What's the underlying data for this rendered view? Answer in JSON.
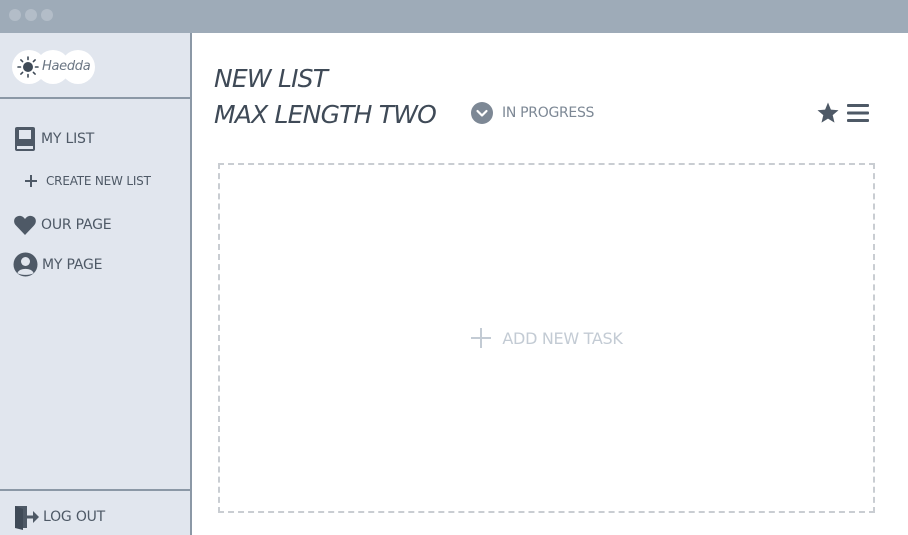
{
  "window": {
    "controls": [
      "close",
      "minimize",
      "maximize"
    ]
  },
  "sidebar": {
    "logo": {
      "text": "Haedda",
      "icon": "sun-icon"
    },
    "items": [
      {
        "label": "MY LIST",
        "icon": "book-icon"
      },
      {
        "label": "CREATE NEW LIST",
        "icon": "plus-icon"
      },
      {
        "label": "OUR PAGE",
        "icon": "heart-icon"
      },
      {
        "label": "MY PAGE",
        "icon": "user-icon"
      }
    ],
    "logout": {
      "label": "LOG OUT",
      "icon": "logout-icon"
    }
  },
  "main": {
    "title_line1": "NEW LIST",
    "title_line2": "MAX LENGTH TWO",
    "status": {
      "label": "IN PROGRESS",
      "icon": "chevron-down-icon"
    },
    "toolbar": {
      "icons": [
        "star-icon",
        "menu-icon"
      ]
    },
    "dropzone": {
      "label": "ADD NEW TASK",
      "icon": "plus-icon"
    }
  },
  "colors": {
    "titlebar": "#9eabb8",
    "sidebar_bg": "#e1e6ee",
    "text_dark": "#4e5966",
    "accent_icon": "#5b6775",
    "dashed_border": "#c9cdd2",
    "muted_text": "#c3cbd4"
  }
}
